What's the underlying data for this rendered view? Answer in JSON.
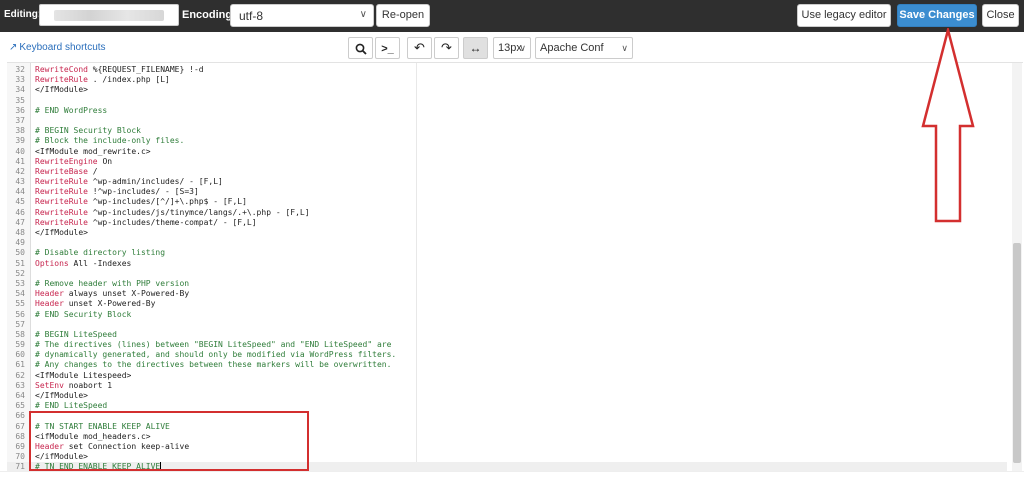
{
  "topbar": {
    "editing_label": "Editing:",
    "encoding_label": "Encoding:",
    "encoding_value": "utf-8",
    "reopen_label": "Re-open",
    "legacy_label": "Use legacy editor",
    "save_label": "Save Changes",
    "close_label": "Close"
  },
  "toolbar": {
    "keyboard_shortcuts": "Keyboard shortcuts",
    "search_icon": "search-icon",
    "font_size": "13px",
    "mode": "Apache Conf"
  },
  "editor": {
    "lines": [
      {
        "n": "32",
        "parts": [
          {
            "c": "kw",
            "t": "RewriteCond"
          },
          {
            "c": "tx",
            "t": " %{REQUEST_FILENAME} !-d"
          }
        ]
      },
      {
        "n": "33",
        "parts": [
          {
            "c": "kw",
            "t": "RewriteRule"
          },
          {
            "c": "tx",
            "t": " . /index.php [L]"
          }
        ]
      },
      {
        "n": "34",
        "parts": [
          {
            "c": "tg",
            "t": "</IfModule>"
          }
        ]
      },
      {
        "n": "35",
        "parts": []
      },
      {
        "n": "36",
        "parts": [
          {
            "c": "cm",
            "t": "# END WordPress"
          }
        ]
      },
      {
        "n": "37",
        "parts": []
      },
      {
        "n": "38",
        "parts": [
          {
            "c": "cm",
            "t": "# BEGIN Security Block"
          }
        ]
      },
      {
        "n": "39",
        "parts": [
          {
            "c": "cm",
            "t": "# Block the include-only files."
          }
        ]
      },
      {
        "n": "40",
        "parts": [
          {
            "c": "tg",
            "t": "<IfModule mod_rewrite.c>"
          }
        ]
      },
      {
        "n": "41",
        "parts": [
          {
            "c": "kw",
            "t": "RewriteEngine"
          },
          {
            "c": "tx",
            "t": " On"
          }
        ]
      },
      {
        "n": "42",
        "parts": [
          {
            "c": "kw",
            "t": "RewriteBase"
          },
          {
            "c": "tx",
            "t": " /"
          }
        ]
      },
      {
        "n": "43",
        "parts": [
          {
            "c": "kw",
            "t": "RewriteRule"
          },
          {
            "c": "tx",
            "t": " ^wp-admin/includes/ - [F,L]"
          }
        ]
      },
      {
        "n": "44",
        "parts": [
          {
            "c": "kw",
            "t": "RewriteRule"
          },
          {
            "c": "tx",
            "t": " !^wp-includes/ - [S=3]"
          }
        ]
      },
      {
        "n": "45",
        "parts": [
          {
            "c": "kw",
            "t": "RewriteRule"
          },
          {
            "c": "tx",
            "t": " ^wp-includes/[^/]+\\.php$ - [F,L]"
          }
        ]
      },
      {
        "n": "46",
        "parts": [
          {
            "c": "kw",
            "t": "RewriteRule"
          },
          {
            "c": "tx",
            "t": " ^wp-includes/js/tinymce/langs/.+\\.php - [F,L]"
          }
        ]
      },
      {
        "n": "47",
        "parts": [
          {
            "c": "kw",
            "t": "RewriteRule"
          },
          {
            "c": "tx",
            "t": " ^wp-includes/theme-compat/ - [F,L]"
          }
        ]
      },
      {
        "n": "48",
        "parts": [
          {
            "c": "tg",
            "t": "</IfModule>"
          }
        ]
      },
      {
        "n": "49",
        "parts": []
      },
      {
        "n": "50",
        "parts": [
          {
            "c": "cm",
            "t": "# Disable directory listing"
          }
        ]
      },
      {
        "n": "51",
        "parts": [
          {
            "c": "kw",
            "t": "Options"
          },
          {
            "c": "tx",
            "t": " All -Indexes"
          }
        ]
      },
      {
        "n": "52",
        "parts": []
      },
      {
        "n": "53",
        "parts": [
          {
            "c": "cm",
            "t": "# Remove header with PHP version"
          }
        ]
      },
      {
        "n": "54",
        "parts": [
          {
            "c": "kw",
            "t": "Header"
          },
          {
            "c": "tx",
            "t": " always unset X-Powered-By"
          }
        ]
      },
      {
        "n": "55",
        "parts": [
          {
            "c": "kw",
            "t": "Header"
          },
          {
            "c": "tx",
            "t": " unset X-Powered-By"
          }
        ]
      },
      {
        "n": "56",
        "parts": [
          {
            "c": "cm",
            "t": "# END Security Block"
          }
        ]
      },
      {
        "n": "57",
        "parts": []
      },
      {
        "n": "58",
        "parts": [
          {
            "c": "cm",
            "t": "# BEGIN LiteSpeed"
          }
        ]
      },
      {
        "n": "59",
        "parts": [
          {
            "c": "cm",
            "t": "# The directives (lines) between \"BEGIN LiteSpeed\" and \"END LiteSpeed\" are"
          }
        ]
      },
      {
        "n": "60",
        "parts": [
          {
            "c": "cm",
            "t": "# dynamically generated, and should only be modified via WordPress filters."
          }
        ]
      },
      {
        "n": "61",
        "parts": [
          {
            "c": "cm",
            "t": "# Any changes to the directives between these markers will be overwritten."
          }
        ]
      },
      {
        "n": "62",
        "parts": [
          {
            "c": "tg",
            "t": "<IfModule Litespeed>"
          }
        ]
      },
      {
        "n": "63",
        "parts": [
          {
            "c": "kw",
            "t": "SetEnv"
          },
          {
            "c": "tx",
            "t": " noabort 1"
          }
        ]
      },
      {
        "n": "64",
        "parts": [
          {
            "c": "tg",
            "t": "</IfModule>"
          }
        ]
      },
      {
        "n": "65",
        "parts": [
          {
            "c": "cm",
            "t": "# END LiteSpeed"
          }
        ]
      },
      {
        "n": "66",
        "parts": []
      },
      {
        "n": "67",
        "parts": [
          {
            "c": "cm",
            "t": "# TN START ENABLE KEEP ALIVE"
          }
        ]
      },
      {
        "n": "68",
        "parts": [
          {
            "c": "tg",
            "t": "<ifModule mod_headers.c>"
          }
        ]
      },
      {
        "n": "69",
        "parts": [
          {
            "c": "kw",
            "t": "Header"
          },
          {
            "c": "tx",
            "t": " set Connection keep-alive"
          }
        ]
      },
      {
        "n": "70",
        "parts": [
          {
            "c": "tg",
            "t": "</ifModule>"
          }
        ]
      },
      {
        "n": "71",
        "parts": [
          {
            "c": "cm",
            "t": "# TN END ENABLE KEEP ALIVE"
          }
        ]
      }
    ]
  },
  "colors": {
    "save_button": "#3b8dd0",
    "topbar": "#2f2f2f",
    "annotation": "#d32f2f",
    "keyword": "#c7254e",
    "comment": "#2f7d3a"
  }
}
